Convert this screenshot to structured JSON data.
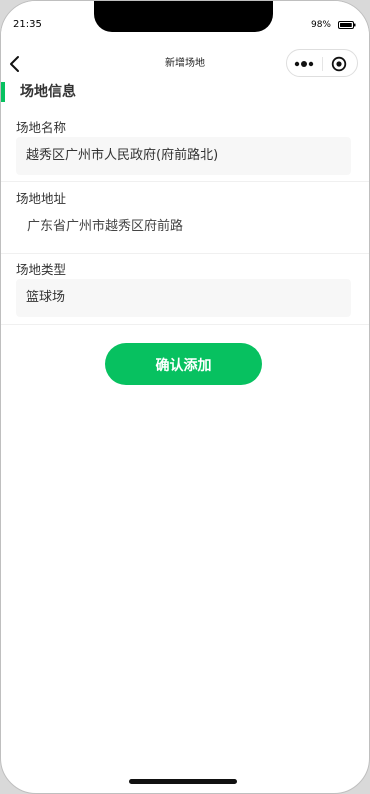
{
  "status_bar": {
    "time": "21:35",
    "battery_percent": "98%",
    "battery_level": 0.98,
    "battery_icon": "battery-icon"
  },
  "nav": {
    "back_icon": "chevron-left-icon",
    "title": "新增场地",
    "more_icon": "more-dots-icon",
    "close_icon": "target-close-icon"
  },
  "section": {
    "title": "场地信息",
    "accent_color": "#07c160"
  },
  "form": {
    "name": {
      "label": "场地名称",
      "value": "越秀区广州市人民政府(府前路北)"
    },
    "address": {
      "label": "场地地址",
      "value": "广东省广州市越秀区府前路"
    },
    "type": {
      "label": "场地类型",
      "value": "篮球场"
    }
  },
  "actions": {
    "confirm_label": "确认添加",
    "confirm_color": "#07c160"
  }
}
